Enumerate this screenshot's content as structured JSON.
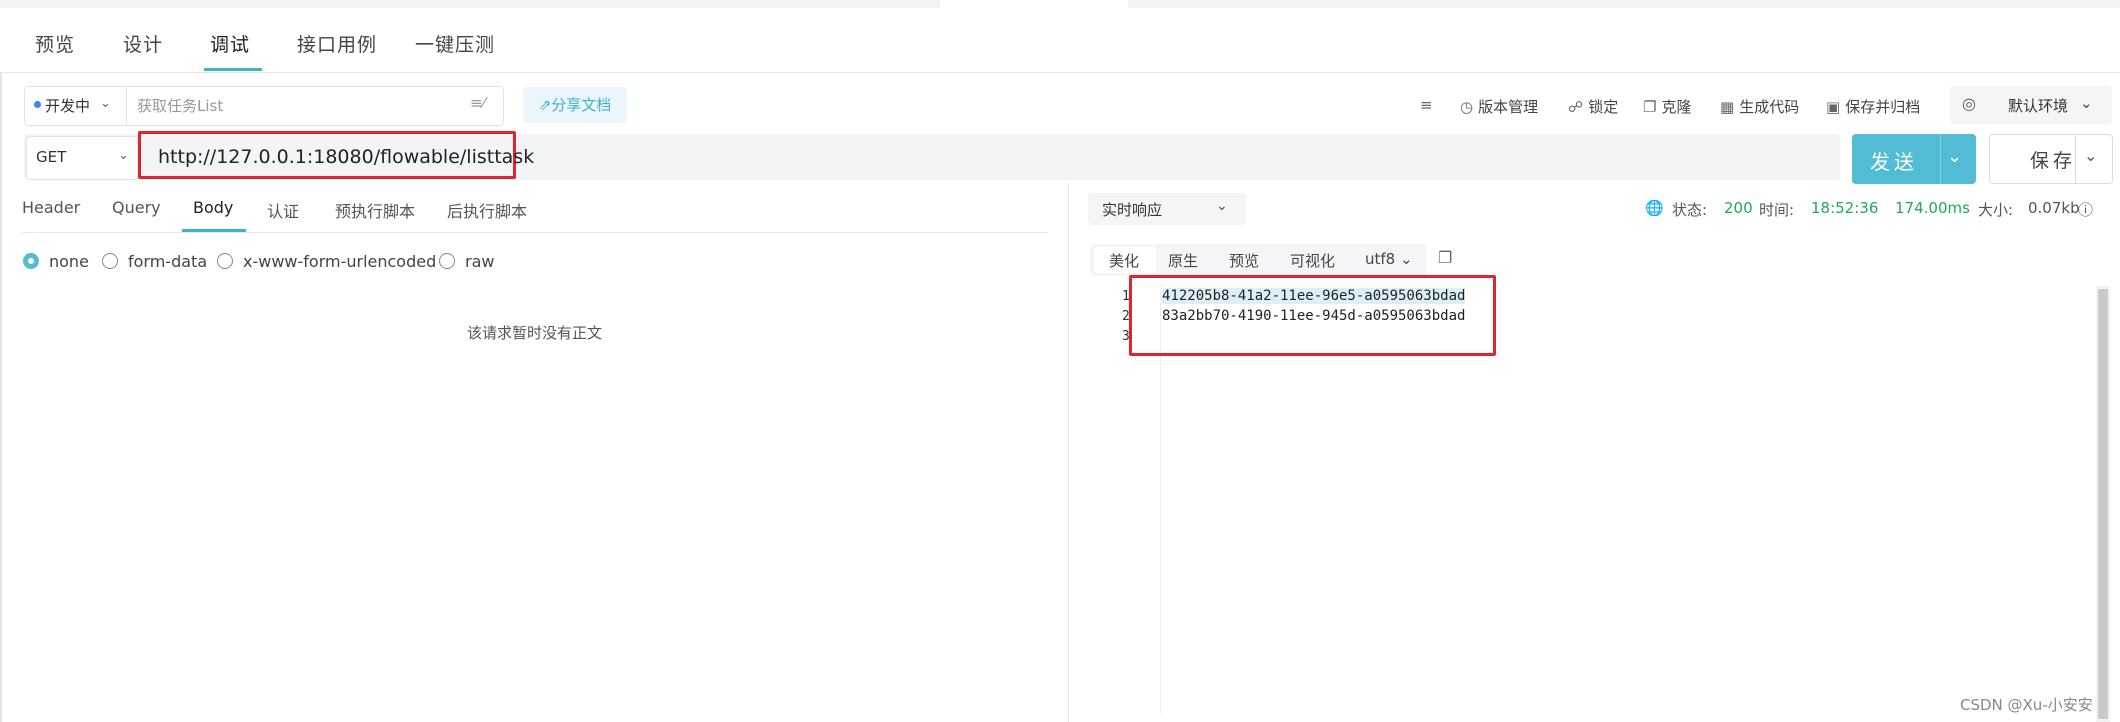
{
  "top_tabs": [
    "预览",
    "设计",
    "调试",
    "接口用例",
    "一键压测"
  ],
  "toolbar": {
    "env_status": "开发中",
    "task_name_placeholder": "获取任务List",
    "share_label": "分享文档",
    "version_label": "版本管理",
    "lock_label": "锁定",
    "clone_label": "克隆",
    "gen_code_label": "生成代码",
    "save_archive_label": "保存并归档",
    "env_select": "默认环境"
  },
  "request": {
    "method": "GET",
    "url": "http://127.0.0.1:18080/flowable/listtask",
    "send_label": "发送",
    "save_label": "保存",
    "tabs": [
      "Header",
      "Query",
      "Body",
      "认证",
      "预执行脚本",
      "后执行脚本"
    ],
    "body_types": [
      "none",
      "form-data",
      "x-www-form-urlencoded",
      "raw"
    ],
    "empty_body_text": "该请求暂时没有正文"
  },
  "response": {
    "mode": "实时响应",
    "status_label": "状态:",
    "status_code": "200",
    "time_label": "时间:",
    "time": "18:52:36",
    "duration": "174.00ms",
    "size_label": "大小:",
    "size": "0.07kb",
    "format_tabs": [
      "美化",
      "原生",
      "预览",
      "可视化"
    ],
    "encoding": "utf8",
    "line_numbers": [
      "1",
      "2",
      "3"
    ],
    "lines": [
      "412205b8-41a2-11ee-96e5-a0595063bdad",
      "83a2bb70-4190-11ee-945d-a0595063bdad"
    ]
  },
  "watermark": "CSDN @Xu-小安安",
  "colors": {
    "accent": "#52bcd4",
    "highlight_red": "#e02430",
    "status_green": "#1faa59"
  }
}
